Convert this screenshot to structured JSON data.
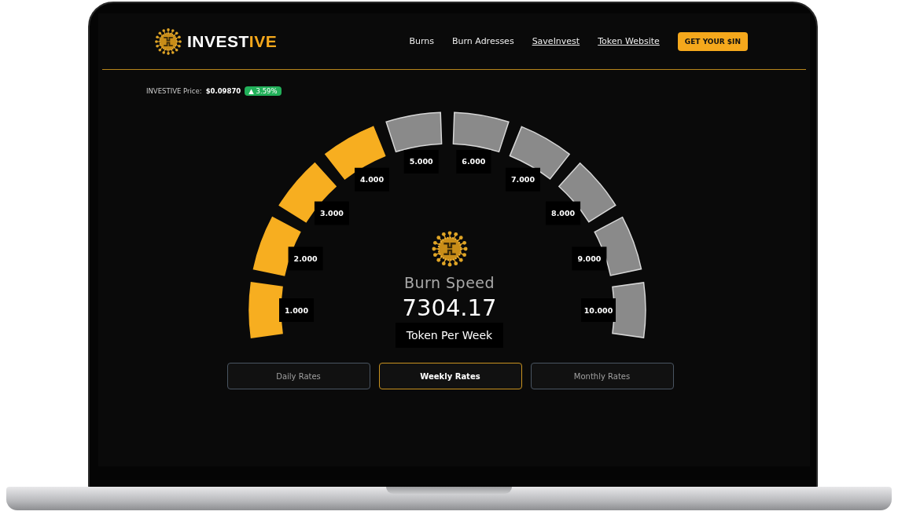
{
  "header": {
    "logo": {
      "prefix": "INVEST",
      "accent": "IVE"
    },
    "nav": [
      {
        "label": "Burns",
        "underlined": false
      },
      {
        "label": "Burn Adresses",
        "underlined": false
      },
      {
        "label": "SaveInvest",
        "underlined": true
      },
      {
        "label": "Token Website",
        "underlined": true
      }
    ],
    "cta": "GET YOUR $IN"
  },
  "price": {
    "label": "INVESTIVE Price:",
    "value": "$0.09870",
    "change": "▲ 3.59%"
  },
  "gauge": {
    "segments": [
      {
        "label": "1.000",
        "active": true
      },
      {
        "label": "2.000",
        "active": true
      },
      {
        "label": "3.000",
        "active": true
      },
      {
        "label": "4.000",
        "active": true
      },
      {
        "label": "5.000",
        "active": false
      },
      {
        "label": "6.000",
        "active": false
      },
      {
        "label": "7.000",
        "active": false
      },
      {
        "label": "8.000",
        "active": false
      },
      {
        "label": "9.000",
        "active": false
      },
      {
        "label": "10.000",
        "active": false
      }
    ],
    "title": "Burn Speed",
    "value": "7304.17",
    "unit": "Token Per Week"
  },
  "rate_tabs": [
    {
      "label": "Daily Rates",
      "selected": false
    },
    {
      "label": "Weekly Rates",
      "selected": true
    },
    {
      "label": "Monthly Rates",
      "selected": false
    }
  ]
}
